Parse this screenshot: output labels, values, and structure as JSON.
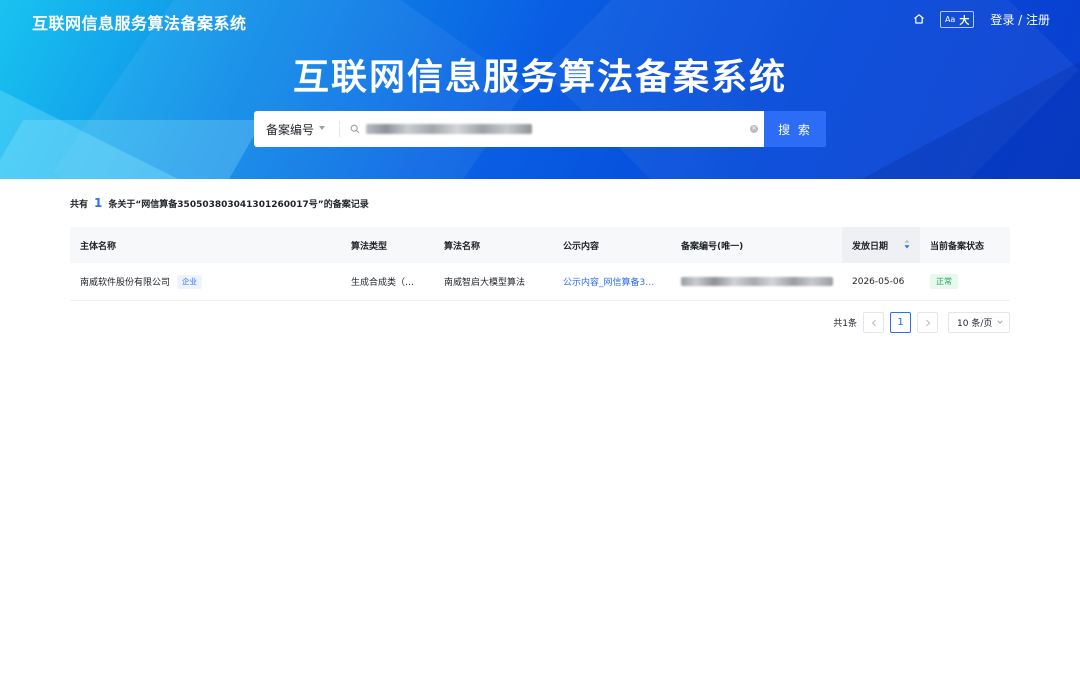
{
  "header": {
    "brand": "互联网信息服务算法备案系统",
    "font_toggle_small": "Aa",
    "font_toggle_big": "大",
    "login_label": "登录 / 注册"
  },
  "hero": {
    "title": "互联网信息服务算法备案系统"
  },
  "search": {
    "type_label": "备案编号",
    "button_label": "搜 索"
  },
  "results": {
    "summary_prefix": "共有",
    "count": "1",
    "summary_suffix": "条关于“网信算备350503803041301260017号”的备案记录"
  },
  "table": {
    "columns": [
      "主体名称",
      "算法类型",
      "算法名称",
      "公示内容",
      "备案编号(唯一)",
      "发放日期",
      "当前备案状态"
    ],
    "rows": [
      {
        "entity": "南威软件股份有限公司",
        "entity_tag": "企业",
        "algo_type": "生成合成类（…",
        "algo_name": "南威智启大模型算法",
        "public_content": "公示内容_网信算备3…",
        "issue_date": "2026-05-06",
        "status": "正常"
      }
    ]
  },
  "pagination": {
    "total": "共1条",
    "current_page": "1",
    "page_size": "10 条/页"
  },
  "colors": {
    "primary": "#2d6cf5",
    "status_green": "#22a45d"
  }
}
